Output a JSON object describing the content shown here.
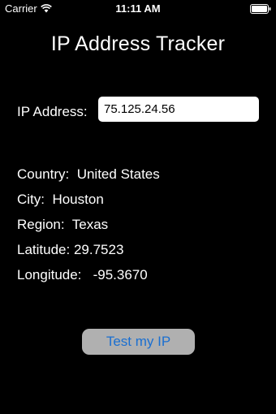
{
  "status_bar": {
    "carrier": "Carrier",
    "time": "11:11 AM",
    "wifi_icon": "wifi-icon",
    "battery_icon": "battery-icon"
  },
  "title": "IP Address Tracker",
  "ip_field": {
    "label": "IP Address:",
    "value": "75.125.24.56"
  },
  "info": {
    "country_label": "Country:",
    "country_value": "United States",
    "city_label": "City:",
    "city_value": "Houston",
    "region_label": "Region:",
    "region_value": "Texas",
    "latitude_label": "Latitude:",
    "latitude_value": "29.7523",
    "longitude_label": "Longitude:",
    "longitude_value": "-95.3670"
  },
  "test_button_label": "Test my IP",
  "colors": {
    "background": "#000000",
    "text": "#ffffff",
    "button_background": "#b0b0b0",
    "button_text": "#1a6fd1"
  }
}
